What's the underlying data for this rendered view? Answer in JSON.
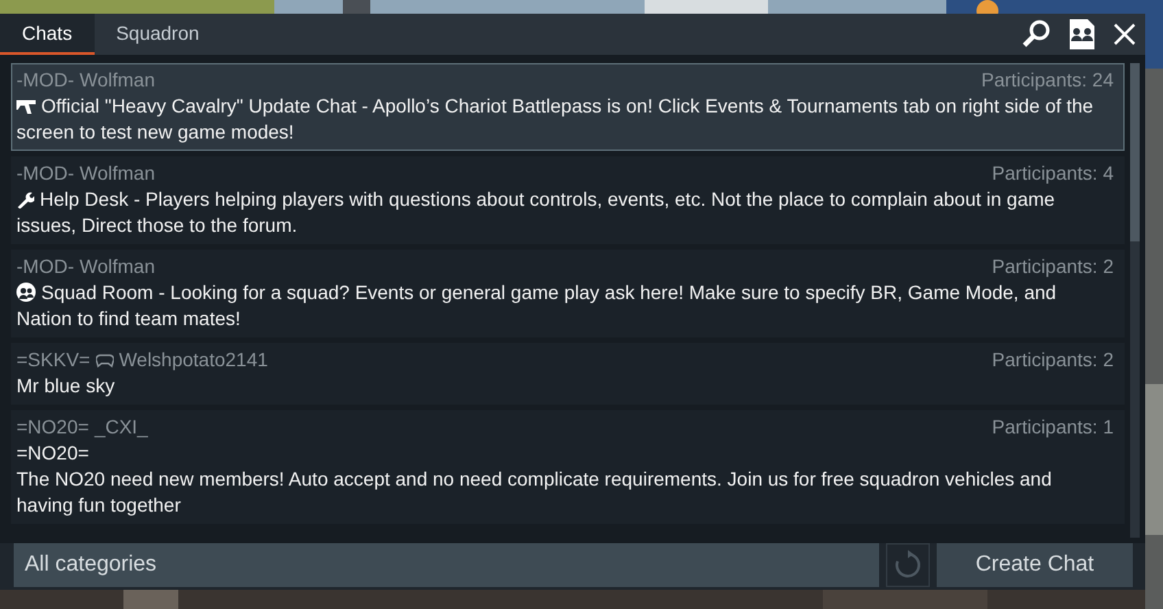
{
  "tabs": [
    {
      "label": "Chats",
      "selected": true
    },
    {
      "label": "Squadron",
      "selected": false
    }
  ],
  "rooms": [
    {
      "tag": "-MOD-",
      "name": "Wolfman",
      "console": false,
      "participants": "Participants: 24",
      "kind": "cannon",
      "message": "Official \"Heavy Cavalry\" Update Chat - Apollo’s Chariot Battlepass is on! Click Events & Tournaments tab on right side of the screen to test new game modes!",
      "selected": true
    },
    {
      "tag": "-MOD-",
      "name": "Wolfman",
      "console": false,
      "participants": "Participants: 4",
      "kind": "wrench",
      "message": "Help Desk - Players helping players with questions about controls, events, etc. Not the place to complain about in game issues, Direct those to the forum.",
      "selected": false
    },
    {
      "tag": "-MOD-",
      "name": "Wolfman",
      "console": false,
      "participants": "Participants: 2",
      "kind": "squad",
      "message": "Squad Room - Looking for a squad? Events or general game play ask here! Make sure to specify BR, Game Mode, and Nation to find team mates!",
      "selected": false
    },
    {
      "tag": "=SKKV=",
      "name": "Welshpotato2141",
      "console": true,
      "participants": "Participants: 2",
      "kind": "plain",
      "message": "Mr blue sky",
      "selected": false
    },
    {
      "tag": "=NO20=",
      "name": "_CXI_",
      "console": false,
      "participants": "Participants: 1",
      "kind": "plain",
      "message": "=NO20=\nThe NO20 need new members! Auto accept and no need complicate requirements. Join us for free squadron vehicles and having fun together",
      "selected": false
    }
  ],
  "category": {
    "value": "All categories"
  },
  "create_button": "Create Chat"
}
